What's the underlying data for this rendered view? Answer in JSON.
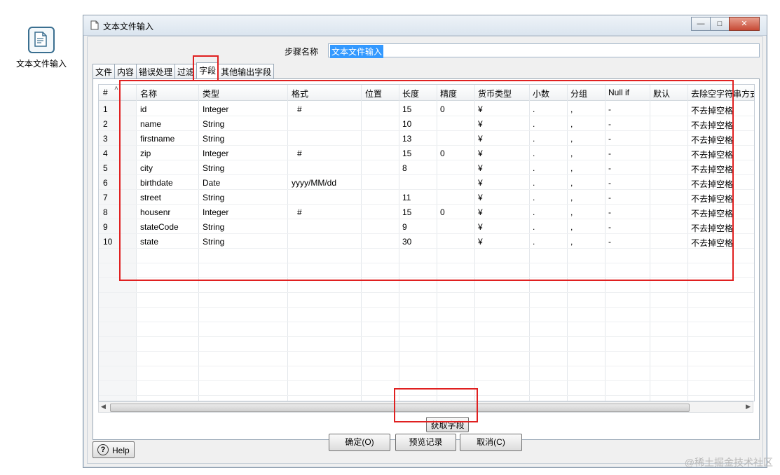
{
  "desktop": {
    "icon_label": "文本文件输入"
  },
  "window": {
    "title": "文本文件输入",
    "buttons": {
      "minimize": "—",
      "maximize": "□",
      "close": "✕"
    }
  },
  "form": {
    "step_name_label": "步骤名称",
    "step_name_value": "文本文件输入"
  },
  "tabs": [
    {
      "label": "文件"
    },
    {
      "label": "内容"
    },
    {
      "label": "错误处理"
    },
    {
      "label": "过滤"
    },
    {
      "label": "字段",
      "active": true
    },
    {
      "label": "其他输出字段"
    }
  ],
  "grid": {
    "columns": [
      "#",
      "名称",
      "类型",
      "格式",
      "位置",
      "长度",
      "精度",
      "货币类型",
      "小数",
      "分组",
      "Null if",
      "默认",
      "去除空字符串方式"
    ],
    "rows": [
      [
        "1",
        "id",
        "Integer",
        "#",
        "",
        "15",
        "0",
        "¥",
        ".",
        ",",
        "-",
        "",
        "不去掉空格"
      ],
      [
        "2",
        "name",
        "String",
        "",
        "",
        "10",
        "",
        "¥",
        ".",
        ",",
        "-",
        "",
        "不去掉空格"
      ],
      [
        "3",
        "firstname",
        "String",
        "",
        "",
        "13",
        "",
        "¥",
        ".",
        ",",
        "-",
        "",
        "不去掉空格"
      ],
      [
        "4",
        "zip",
        "Integer",
        "#",
        "",
        "15",
        "0",
        "¥",
        ".",
        ",",
        "-",
        "",
        "不去掉空格"
      ],
      [
        "5",
        "city",
        "String",
        "",
        "",
        "8",
        "",
        "¥",
        ".",
        ",",
        "-",
        "",
        "不去掉空格"
      ],
      [
        "6",
        "birthdate",
        "Date",
        "yyyy/MM/dd",
        "",
        "",
        "",
        "¥",
        ".",
        ",",
        "-",
        "",
        "不去掉空格"
      ],
      [
        "7",
        "street",
        "String",
        "",
        "",
        "11",
        "",
        "¥",
        ".",
        ",",
        "-",
        "",
        "不去掉空格"
      ],
      [
        "8",
        "housenr",
        "Integer",
        "#",
        "",
        "15",
        "0",
        "¥",
        ".",
        ",",
        "-",
        "",
        "不去掉空格"
      ],
      [
        "9",
        "stateCode",
        "String",
        "",
        "",
        "9",
        "",
        "¥",
        ".",
        ",",
        "-",
        "",
        "不去掉空格"
      ],
      [
        "10",
        "state",
        "String",
        "",
        "",
        "30",
        "",
        "¥",
        ".",
        ",",
        "-",
        "",
        "不去掉空格"
      ]
    ]
  },
  "buttons": {
    "get_fields": "获取字段",
    "help": "Help",
    "ok": "确定(O)",
    "preview": "预览记录",
    "cancel": "取消(C)"
  },
  "watermark": "@稀土掘金技术社区"
}
